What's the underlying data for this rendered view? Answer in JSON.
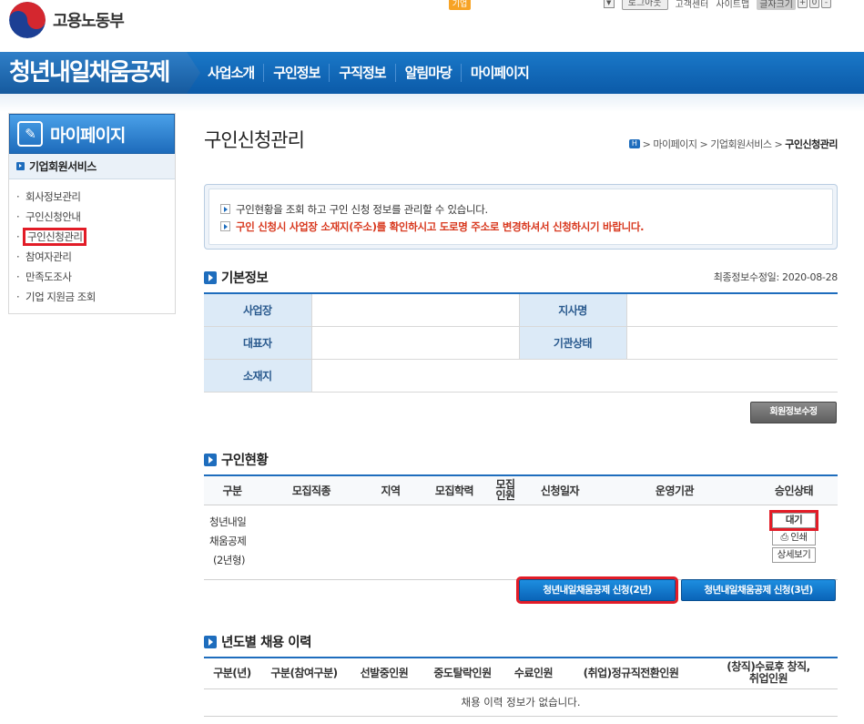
{
  "header": {
    "ministry": "고용노동부",
    "util_tag": "기업",
    "logout": "로그아웃",
    "links": [
      "고객센터",
      "사이트맵"
    ],
    "zoom_label": "글자크기",
    "zoom_buttons": [
      "+",
      "0",
      "-"
    ]
  },
  "gnb": {
    "title": "청년내일채움공제",
    "menu": [
      "사업소개",
      "구인정보",
      "구직정보",
      "알림마당",
      "마이페이지"
    ]
  },
  "lnb": {
    "title": "마이페이지",
    "subtitle": "기업회원서비스",
    "items": [
      "회사정보관리",
      "구인신청안내",
      "구인신청관리",
      "참여자관리",
      "만족도조사",
      "기업 지원금 조회"
    ]
  },
  "page": {
    "title": "구인신청관리",
    "breadcrumb": [
      "마이페이지",
      "기업회원서비스",
      "구인신청관리"
    ],
    "home_icon": "H"
  },
  "notice": {
    "line1": "구인현황을 조회 하고 구인 신청 정보를 관리할 수 있습니다.",
    "line2": "구인 신청시 사업장 소재지(주소)를 확인하시고 도로명 주소로 변경하셔서 신청하시기 바랍니다."
  },
  "basic": {
    "title": "기본정보",
    "last_modified": "최종정보수정일: 2020-08-28",
    "labels": {
      "workplace": "사업장",
      "branch": "지사명",
      "ceo": "대표자",
      "status": "기관상태",
      "address": "소재지"
    },
    "edit_button": "회원정보수정"
  },
  "recruit": {
    "title": "구인현황",
    "headers": [
      "구분",
      "모집직종",
      "지역",
      "모집학력",
      "모집\n인원",
      "신청일자",
      "운영기관",
      "승인상태"
    ],
    "row": {
      "category_line1": "청년내일",
      "category_line2": "채움공제",
      "category_line3": "(2년형)",
      "status_button": "대기",
      "print_button": "인쇄",
      "detail_button": "상세보기"
    },
    "apply_2y": "청년내일채움공제 신청(2년)",
    "apply_3y": "청년내일채움공제 신청(3년)"
  },
  "history": {
    "title": "년도별 채용 이력",
    "headers": [
      "구분(년)",
      "구분(참여구분)",
      "선발중인원",
      "중도탈락인원",
      "수료인원",
      "(취업)정규직전환인원",
      "(창직)수료후 창직,\n취업인원"
    ],
    "empty": "채용 이력 정보가 없습니다."
  }
}
